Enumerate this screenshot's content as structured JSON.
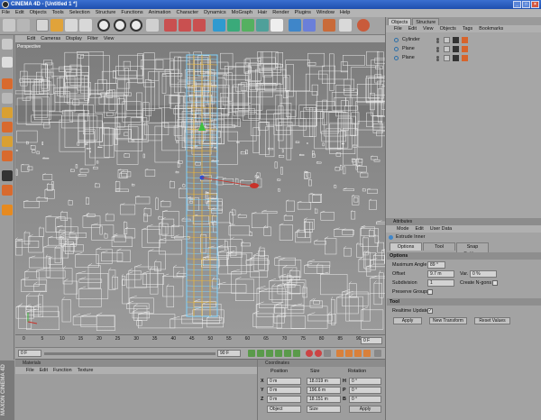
{
  "window": {
    "title": "CINEMA 4D - [Untitled 1 *]"
  },
  "menubar": [
    "File",
    "Edit",
    "Objects",
    "Tools",
    "Selection",
    "Structure",
    "Functions",
    "Animation",
    "Character",
    "Dynamics",
    "MoGraph",
    "Hair",
    "Render",
    "Plugins",
    "Window",
    "Help"
  ],
  "viewport": {
    "menu": [
      "Edit",
      "Cameras",
      "Display",
      "Filter",
      "View"
    ],
    "label": "Perspective"
  },
  "timeline": {
    "ticks": [
      "0",
      "5",
      "10",
      "15",
      "20",
      "25",
      "30",
      "35",
      "40",
      "45",
      "50",
      "55",
      "60",
      "65",
      "70",
      "75",
      "80",
      "85",
      "90"
    ],
    "current_frame": "0 F"
  },
  "transport": {
    "start": "0 F",
    "end": "90 F"
  },
  "materials": {
    "title": "Materials",
    "menu": [
      "File",
      "Edit",
      "Function",
      "Texture"
    ]
  },
  "coordinates": {
    "title": "Coordinates",
    "headers": [
      "Position",
      "Size",
      "Rotation"
    ],
    "rows": [
      {
        "axis": "X",
        "pos": "0 m",
        "size": "18.019 m",
        "rot_label": "H",
        "rot": "0 °"
      },
      {
        "axis": "Y",
        "pos": "0 m",
        "size": "196.6 m",
        "rot_label": "P",
        "rot": "0 °"
      },
      {
        "axis": "Z",
        "pos": "0 m",
        "size": "18.151 m",
        "rot_label": "B",
        "rot": "0 °"
      }
    ],
    "mode": "Object",
    "size_mode": "Size",
    "apply": "Apply"
  },
  "brand": "MAXON CINEMA 4D",
  "objects_panel": {
    "tabs": [
      "Objects",
      "Structure"
    ],
    "menu": [
      "File",
      "Edit",
      "View",
      "Objects",
      "Tags",
      "Bookmarks"
    ],
    "items": [
      "Cylinder",
      "Plane",
      "Plane"
    ]
  },
  "attributes": {
    "title": "Attributes",
    "menu": [
      "Mode",
      "Edit",
      "User Data"
    ],
    "tool_name": "Extrude Inner",
    "tabs": [
      "Options",
      "Tool",
      "Snap Settings"
    ],
    "options_title": "Options",
    "fields": {
      "max_angle_label": "Maximum Angle",
      "max_angle": "89 °",
      "offset_label": "Offset",
      "offset": "9.7 m",
      "var_label": "Var.",
      "var": "0 %",
      "subdiv_label": "Subdivision",
      "subdiv": "1",
      "ngons_label": "Create N-gons",
      "preserve_label": "Preserve Groups"
    },
    "tool_title": "Tool",
    "realtime_label": "Realtime Update",
    "buttons": [
      "Apply",
      "New Transform",
      "Reset Values"
    ]
  },
  "colors": {
    "accent": "#2f6fd6",
    "wire": "#ffffff",
    "selected_wire": "#7fd4ff",
    "highlight": "#e8b53c"
  }
}
